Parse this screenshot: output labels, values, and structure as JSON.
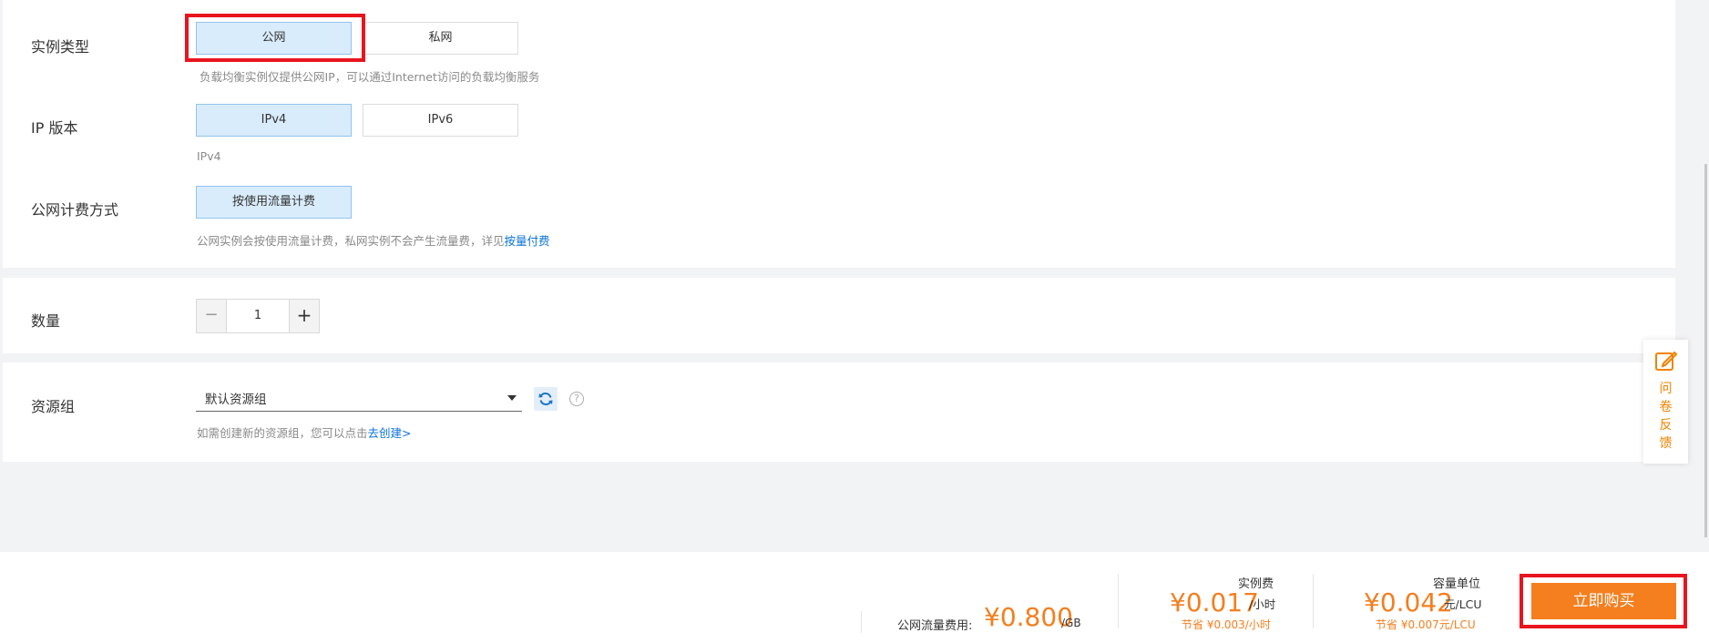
{
  "instance_type": {
    "label": "实例类型",
    "options": [
      "公网",
      "私网"
    ],
    "selected": "公网",
    "hint": "负载均衡实例仅提供公网IP，可以通过Internet访问的负载均衡服务"
  },
  "ip_version": {
    "label": "IP 版本",
    "options": [
      "IPv4",
      "IPv6"
    ],
    "selected": "IPv4",
    "hint": "IPv4"
  },
  "billing": {
    "label": "公网计费方式",
    "option": "按使用流量计费",
    "hint_text": "公网实例会按使用流量计费，私网实例不会产生流量费，详见",
    "hint_link": "按量付费"
  },
  "quantity": {
    "label": "数量",
    "minus": "−",
    "value": "1",
    "plus": "+"
  },
  "resource_group": {
    "label": "资源组",
    "selected": "默认资源组",
    "hint_text": "如需创建新的资源组，您可以点击",
    "hint_link": "去创建>",
    "help_icon": "?"
  },
  "feedback": {
    "chars": [
      "问",
      "卷",
      "反",
      "馈"
    ]
  },
  "footer": {
    "traffic_label": "公网流量费用:",
    "traffic_price": "¥0.800",
    "traffic_unit": "/GB",
    "instance_fee_title": "实例费",
    "instance_fee_price": "¥0.017",
    "instance_fee_unit": "/小时",
    "instance_fee_save": "节省 ¥0.003/小时",
    "lcu_title": "容量单位",
    "lcu_price": "¥0.042",
    "lcu_unit": "元/LCU",
    "lcu_save": "节省 ¥0.007元/LCU",
    "buy_label": "立即购买"
  },
  "colors": {
    "accent_orange": "#f57e1e",
    "selected_bg": "#d9ecfb",
    "link_blue": "#0a73d9",
    "highlight_red": "#e8141e"
  }
}
